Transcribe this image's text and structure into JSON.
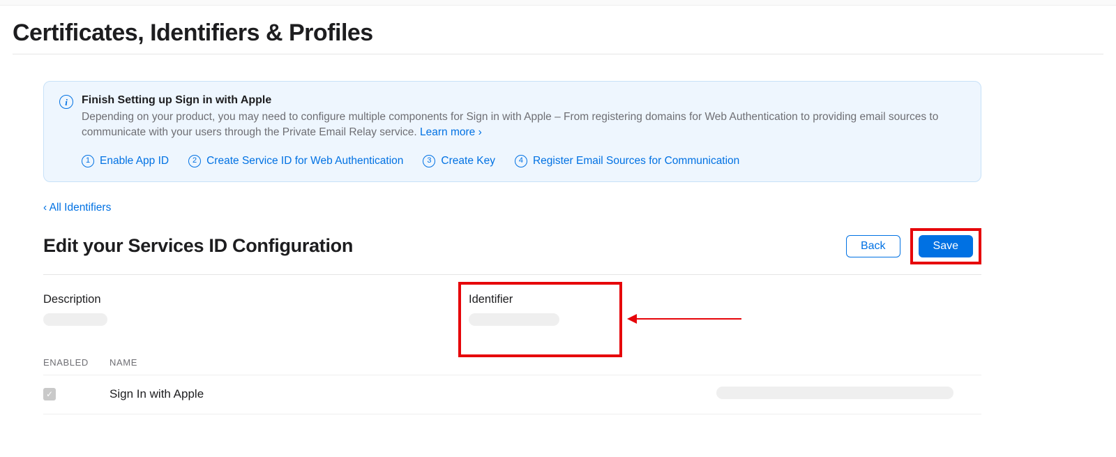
{
  "page_title": "Certificates, Identifiers & Profiles",
  "info": {
    "icon_glyph": "i",
    "title": "Finish Setting up Sign in with Apple",
    "description": "Depending on your product, you may need to configure multiple components for Sign in with Apple – From registering domains for Web Authentication to providing email sources to communicate with your users through the Private Email Relay service. ",
    "learn_more": "Learn more ›",
    "steps": [
      {
        "num": "1",
        "label": "Enable App ID"
      },
      {
        "num": "2",
        "label": "Create Service ID for Web Authentication"
      },
      {
        "num": "3",
        "label": "Create Key"
      },
      {
        "num": "4",
        "label": "Register Email Sources for Communication"
      }
    ]
  },
  "back_link": "‹ All Identifiers",
  "section_title": "Edit your Services ID Configuration",
  "buttons": {
    "back": "Back",
    "save": "Save"
  },
  "fields": {
    "description_label": "Description",
    "identifier_label": "Identifier"
  },
  "capabilities": {
    "header_enabled": "ENABLED",
    "header_name": "NAME",
    "rows": [
      {
        "name": "Sign In with Apple",
        "enabled_glyph": "✓"
      }
    ]
  }
}
